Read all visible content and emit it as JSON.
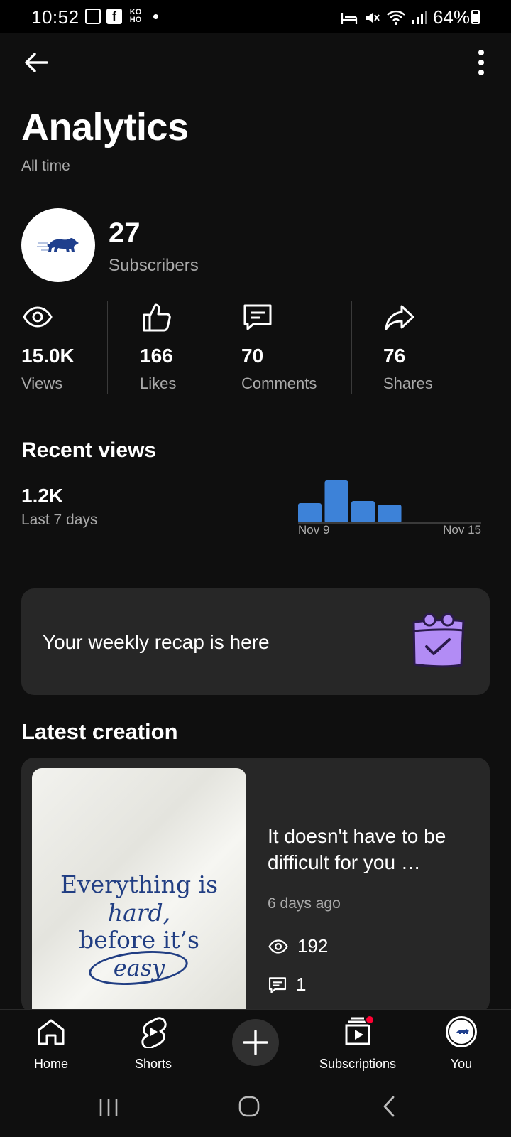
{
  "status_bar": {
    "time": "10:52",
    "notif_ko": "KO",
    "notif_ho": "HO",
    "battery": "64%"
  },
  "page": {
    "title": "Analytics",
    "period": "All time"
  },
  "channel": {
    "subscriber_count": "27",
    "subscriber_label": "Subscribers"
  },
  "stats": [
    {
      "icon": "eye-icon",
      "value": "15.0K",
      "label": "Views"
    },
    {
      "icon": "thumbs-up-icon",
      "value": "166",
      "label": "Likes"
    },
    {
      "icon": "comment-icon",
      "value": "70",
      "label": "Comments"
    },
    {
      "icon": "share-icon",
      "value": "76",
      "label": "Shares"
    }
  ],
  "recent_views": {
    "title": "Recent views",
    "value": "1.2K",
    "period": "Last 7 days",
    "start_label": "Nov 9",
    "end_label": "Nov 15"
  },
  "chart_data": {
    "type": "bar",
    "categories": [
      "Nov 9",
      "Nov 10",
      "Nov 11",
      "Nov 12",
      "Nov 13",
      "Nov 14",
      "Nov 15"
    ],
    "values": [
      28,
      60,
      31,
      26,
      0,
      1,
      0
    ],
    "bar_color": "#3d82d8",
    "baseline_color": "#3a3a3a"
  },
  "recap": {
    "text": "Your weekly recap is here",
    "icon": "calendar-check-icon"
  },
  "latest_creation": {
    "title": "Latest creation",
    "thumbnail_lines": [
      "Everything is",
      "hard,",
      "before it’s",
      "easy"
    ],
    "video_title": "It doesn't have to be difficult for you …",
    "age": "6 days ago",
    "views": "192",
    "comments": "1"
  },
  "bottom_nav": {
    "home": "Home",
    "shorts": "Shorts",
    "subscriptions": "Subscriptions",
    "you": "You"
  },
  "colors": {
    "background": "#0f0f0f",
    "card": "#272727",
    "accent_blue": "#3d82d8",
    "recap_purple": "#b28cf5",
    "notification_red": "#ff0033"
  }
}
